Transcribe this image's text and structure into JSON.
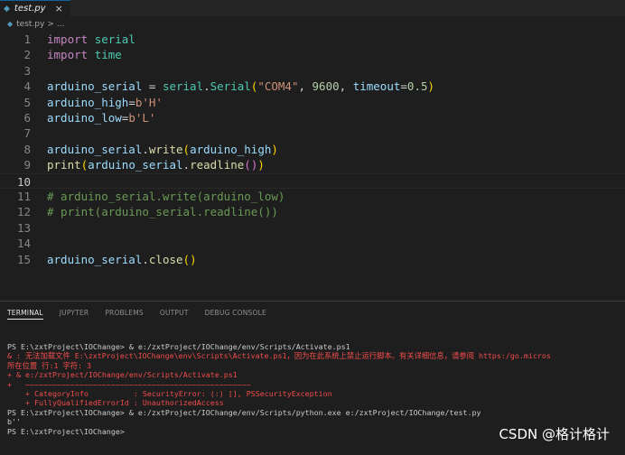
{
  "tab": {
    "label": "test.py",
    "icon": "python-file-icon",
    "close": "×"
  },
  "breadcrumb": {
    "file": "test.py",
    "separator": ">",
    "more": "..."
  },
  "editor": {
    "line_numbers": [
      "1",
      "2",
      "3",
      "4",
      "5",
      "6",
      "7",
      "8",
      "9",
      "10",
      "11",
      "12",
      "13",
      "14",
      "15"
    ],
    "current_line": "10",
    "tokens": {
      "import": "import",
      "serial": "serial",
      "time": "time",
      "arduino_serial": "arduino_serial",
      "eq": " = ",
      "dot": ".",
      "Serial": "Serial",
      "lp": "(",
      "rp": ")",
      "com4": "\"COM4\"",
      "comma": ", ",
      "baud": "9600",
      "timeout": "timeout",
      "eq2": "=",
      "tval": "0.5",
      "arduino_high": "arduino_high",
      "arduino_low": "arduino_low",
      "b": "b",
      "sH": "'H'",
      "sL": "'L'",
      "write": "write",
      "print": "print",
      "readline": "readline",
      "close": "close",
      "c11": "# arduino_serial.write(arduino_low)",
      "c12": "# print(arduino_serial.readline())"
    }
  },
  "panel": {
    "tabs": [
      "TERMINAL",
      "JUPYTER",
      "PROBLEMS",
      "OUTPUT",
      "DEBUG CONSOLE"
    ],
    "active_tab": "TERMINAL"
  },
  "terminal": {
    "lines": [
      {
        "text": "PS E:\\zxtProject\\IOChange> & e:/zxtProject/IOChange/env/Scripts/Activate.ps1",
        "color": "white"
      },
      {
        "text": "& : 无法加载文件 E:\\zxtProject\\IOChange\\env\\Scripts\\Activate.ps1，因为在此系统上禁止运行脚本。有关详细信息，请参阅 https:/go.micros",
        "color": "red"
      },
      {
        "text": "所在位置 行:1 字符: 3",
        "color": "red"
      },
      {
        "text": "+ & e:/zxtProject/IOChange/env/Scripts/Activate.ps1",
        "color": "red"
      },
      {
        "text": "+   ~~~~~~~~~~~~~~~~~~~~~~~~~~~~~~~~~~~~~~~~~~~~~~~~~~",
        "color": "red"
      },
      {
        "text": "    + CategoryInfo          : SecurityError: (:) [], PSSecurityException",
        "color": "red"
      },
      {
        "text": "    + FullyQualifiedErrorId : UnauthorizedAccess",
        "color": "red"
      },
      {
        "text": "PS E:\\zxtProject\\IOChange> & e:/zxtProject/IOChange/env/Scripts/python.exe e:/zxtProject/IOChange/test.py",
        "color": "white"
      },
      {
        "text": "b''",
        "color": "white"
      },
      {
        "text": "PS E:\\zxtProject\\IOChange>",
        "color": "white"
      }
    ]
  },
  "watermark": "CSDN @格计格计",
  "colors": {
    "background": "#1e1e1e",
    "accent": "#0e639c",
    "error": "#f14c4c"
  }
}
